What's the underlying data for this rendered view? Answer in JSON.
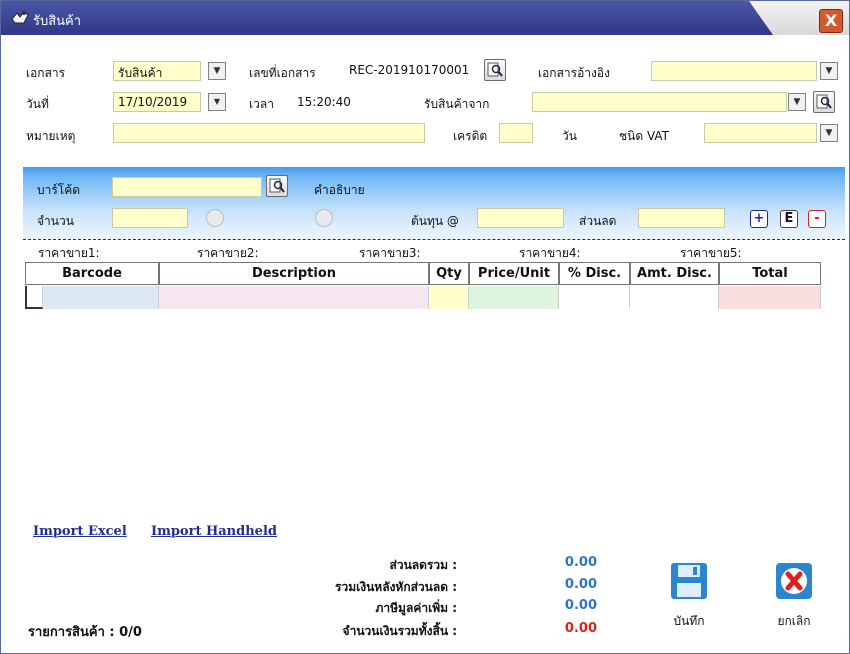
{
  "window": {
    "title": "รับสินค้า",
    "close_glyph": "X"
  },
  "header": {
    "doc_label": "เอกสาร",
    "doc_value": "รับสินค้า",
    "docno_label": "เลขที่เอกสาร",
    "docno_value": "REC-201910170001",
    "ref_label": "เอกสารอ้างอิง",
    "ref_value": "",
    "date_label": "วันที่",
    "date_value": "17/10/2019",
    "time_label": "เวลา",
    "time_value": "15:20:40",
    "from_label": "รับสินค้าจาก",
    "from_value": "",
    "note_label": "หมายเหตุ",
    "note_value": "",
    "credit_label": "เครดิต",
    "credit_value": "",
    "day_label": "วัน",
    "vat_label": "ชนิด VAT",
    "vat_value": ""
  },
  "entry": {
    "barcode_label": "บาร์โค้ด",
    "barcode_value": "",
    "desc_label": "คำอธิบาย",
    "qty_label": "จำนวน",
    "qty_value": "",
    "cost_label": "ต้นทุน @",
    "cost_value": "",
    "discount_label": "ส่วนลด",
    "discount_value": "",
    "add_glyph": "+",
    "edit_glyph": "E",
    "remove_glyph": "-"
  },
  "prices": [
    "ราคาขาย1:",
    "ราคาขาย2:",
    "ราคาขาย3:",
    "ราคาขาย4:",
    "ราคาขาย5:"
  ],
  "table": {
    "columns": [
      "Barcode",
      "Description",
      "Qty",
      "Price/Unit",
      "% Disc.",
      "Amt. Disc.",
      "Total"
    ]
  },
  "links": {
    "import_excel": "Import Excel",
    "import_handheld": "Import Handheld"
  },
  "summary": {
    "discount_total_label": "ส่วนลดรวม :",
    "discount_total_value": "0.00",
    "after_discount_label": "รวมเงินหลังหักส่วนลด :",
    "after_discount_value": "0.00",
    "vat_label": "ภาษีมูลค่าเพิ่ม :",
    "vat_value": "0.00",
    "grand_total_label": "จำนวนเงินรวมทั้งสิ้น :",
    "grand_total_value": "0.00",
    "items_label": "รายการสินค้า : 0/0"
  },
  "actions": {
    "save_label": "บันทึก",
    "cancel_label": "ยกเลิก"
  },
  "colors": {
    "title_bar": "#3a43a0",
    "field_yellow": "#ffffcc",
    "accent_blue": "#2a77c8",
    "total_red": "#e02020"
  }
}
